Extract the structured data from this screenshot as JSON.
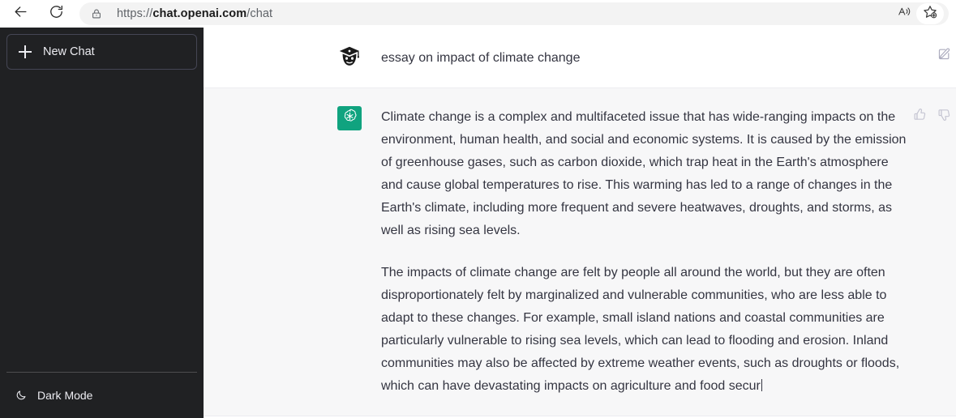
{
  "browser": {
    "back_icon": "back-arrow-icon",
    "reload_icon": "reload-icon",
    "lock_icon": "lock-icon",
    "url_scheme": "https://",
    "url_host": "chat.openai.com",
    "url_path": "/chat",
    "url_full": "https://chat.openai.com/chat",
    "read_aloud_icon": "read-aloud-icon",
    "favorite_icon": "add-favorite-star-icon"
  },
  "sidebar": {
    "new_chat_label": "New Chat",
    "new_chat_icon": "plus-icon",
    "footer_items": [
      {
        "label": "Dark Mode",
        "icon": "moon-icon"
      }
    ]
  },
  "chat": {
    "user_message": {
      "avatar_icon": "graduation-cap-avatar",
      "text": "essay on impact of climate change",
      "edit_icon": "edit-pencil-icon"
    },
    "assistant_message": {
      "avatar_icon": "openai-logo-icon",
      "paragraphs": [
        "Climate change is a complex and multifaceted issue that has wide-ranging impacts on the environment, human health, and social and economic systems. It is caused by the emission of greenhouse gases, such as carbon dioxide, which trap heat in the Earth's atmosphere and cause global temperatures to rise. This warming has led to a range of changes in the Earth's climate, including more frequent and severe heatwaves, droughts, and storms, as well as rising sea levels.",
        "The impacts of climate change are felt by people all around the world, but they are often disproportionately felt by marginalized and vulnerable communities, who are less able to adapt to these changes. For example, small island nations and coastal communities are particularly vulnerable to rising sea levels, which can lead to flooding and erosion. Inland communities may also be affected by extreme weather events, such as droughts or floods, which can have devastating impacts on agriculture and food secur"
      ],
      "streaming": true,
      "thumbs_up_icon": "thumbs-up-icon",
      "thumbs_down_icon": "thumbs-down-icon"
    }
  },
  "colors": {
    "sidebar_bg": "#202123",
    "assistant_bg": "#f7f7f8",
    "brand_green": "#10a37f",
    "text": "#343541"
  }
}
